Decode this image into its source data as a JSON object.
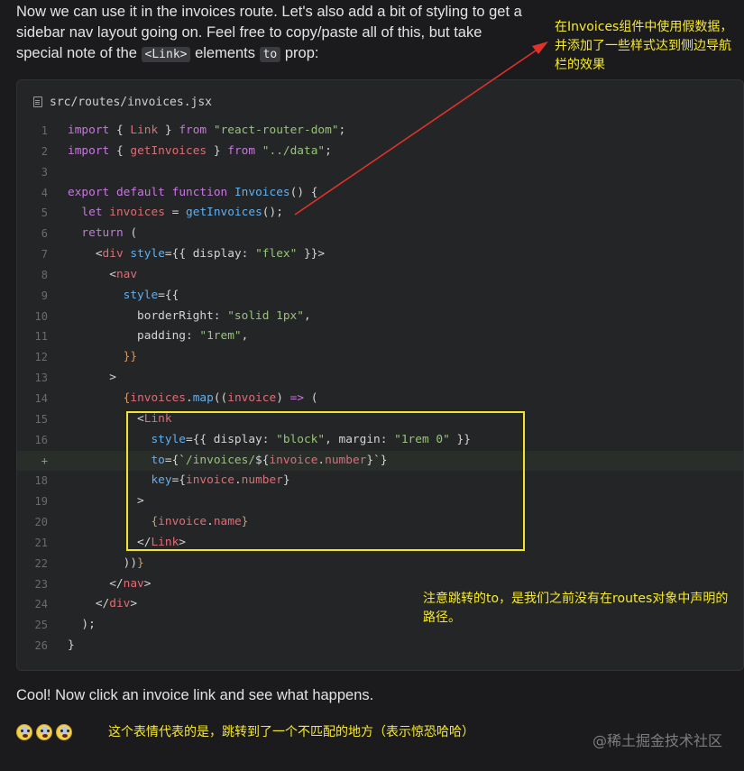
{
  "intro": {
    "part1": "Now we can use it in the invoices route. Let's also add a bit of styling to get a sidebar nav layout going on. Feel free to copy/paste all of this, but take special note of the ",
    "chip1": "<Link>",
    "part2": " elements ",
    "chip2": "to",
    "part3": " prop:"
  },
  "code_card": {
    "filename": "src/routes/invoices.jsx",
    "icon": "file-icon",
    "lines": [
      {
        "n": "1",
        "added": false,
        "tokens": [
          [
            "kw",
            "import"
          ],
          [
            "pl",
            " { "
          ],
          [
            "var",
            "Link"
          ],
          [
            "pl",
            " } "
          ],
          [
            "kw",
            "from"
          ],
          [
            "pl",
            " "
          ],
          [
            "str",
            "\"react-router-dom\""
          ],
          [
            "pl",
            ";"
          ]
        ]
      },
      {
        "n": "2",
        "added": false,
        "tokens": [
          [
            "kw",
            "import"
          ],
          [
            "pl",
            " { "
          ],
          [
            "var",
            "getInvoices"
          ],
          [
            "pl",
            " } "
          ],
          [
            "kw",
            "from"
          ],
          [
            "pl",
            " "
          ],
          [
            "str",
            "\"../data\""
          ],
          [
            "pl",
            ";"
          ]
        ]
      },
      {
        "n": "3",
        "added": false,
        "tokens": []
      },
      {
        "n": "4",
        "added": false,
        "tokens": [
          [
            "kw",
            "export"
          ],
          [
            "pl",
            " "
          ],
          [
            "kw",
            "default"
          ],
          [
            "pl",
            " "
          ],
          [
            "kw",
            "function"
          ],
          [
            "pl",
            " "
          ],
          [
            "fn",
            "Invoices"
          ],
          [
            "pl",
            "() {"
          ]
        ]
      },
      {
        "n": "5",
        "added": false,
        "tokens": [
          [
            "pl",
            "  "
          ],
          [
            "kw",
            "let"
          ],
          [
            "pl",
            " "
          ],
          [
            "var",
            "invoices"
          ],
          [
            "pl",
            " = "
          ],
          [
            "fn",
            "getInvoices"
          ],
          [
            "pl",
            "();"
          ]
        ]
      },
      {
        "n": "6",
        "added": false,
        "tokens": [
          [
            "pl",
            "  "
          ],
          [
            "kw",
            "return"
          ],
          [
            "pl",
            " ("
          ]
        ]
      },
      {
        "n": "7",
        "added": false,
        "tokens": [
          [
            "pl",
            "    <"
          ],
          [
            "tag",
            "div"
          ],
          [
            "pl",
            " "
          ],
          [
            "attr",
            "style"
          ],
          [
            "pl",
            "={{ display: "
          ],
          [
            "str",
            "\"flex\""
          ],
          [
            "pl",
            " }}>"
          ]
        ]
      },
      {
        "n": "8",
        "added": false,
        "tokens": [
          [
            "pl",
            "      <"
          ],
          [
            "tag",
            "nav"
          ]
        ]
      },
      {
        "n": "9",
        "added": false,
        "tokens": [
          [
            "pl",
            "        "
          ],
          [
            "attr",
            "style"
          ],
          [
            "pl",
            "={{"
          ]
        ]
      },
      {
        "n": "10",
        "added": false,
        "tokens": [
          [
            "pl",
            "          borderRight: "
          ],
          [
            "str",
            "\"solid 1px\""
          ],
          [
            "pl",
            ","
          ]
        ]
      },
      {
        "n": "11",
        "added": false,
        "tokens": [
          [
            "pl",
            "          padding: "
          ],
          [
            "str",
            "\"1rem\""
          ],
          [
            "pl",
            ","
          ]
        ]
      },
      {
        "n": "12",
        "added": false,
        "tokens": [
          [
            "pl",
            "        "
          ],
          [
            "br",
            "}}"
          ]
        ]
      },
      {
        "n": "13",
        "added": false,
        "tokens": [
          [
            "pl",
            "      >"
          ]
        ]
      },
      {
        "n": "14",
        "added": false,
        "tokens": [
          [
            "pl",
            "        "
          ],
          [
            "br",
            "{"
          ],
          [
            "var",
            "invoices"
          ],
          [
            "pl",
            "."
          ],
          [
            "fn",
            "map"
          ],
          [
            "pl",
            "(("
          ],
          [
            "var",
            "invoice"
          ],
          [
            "pl",
            ") "
          ],
          [
            "kw",
            "=>"
          ],
          [
            "pl",
            " ("
          ]
        ]
      },
      {
        "n": "15",
        "added": false,
        "tokens": [
          [
            "pl",
            "          <"
          ],
          [
            "tag",
            "Link"
          ]
        ]
      },
      {
        "n": "16",
        "added": false,
        "tokens": [
          [
            "pl",
            "            "
          ],
          [
            "attr",
            "style"
          ],
          [
            "pl",
            "={{ display: "
          ],
          [
            "str",
            "\"block\""
          ],
          [
            "pl",
            ", margin: "
          ],
          [
            "str",
            "\"1rem 0\""
          ],
          [
            "pl",
            " }}"
          ]
        ]
      },
      {
        "n": "+",
        "added": true,
        "tokens": [
          [
            "pl",
            "            "
          ],
          [
            "attr",
            "to"
          ],
          [
            "pl",
            "={`"
          ],
          [
            "str",
            "/invoices/"
          ],
          [
            "pl",
            "${"
          ],
          [
            "var",
            "invoice"
          ],
          [
            "pl",
            "."
          ],
          [
            "var",
            "number"
          ],
          [
            "pl",
            "}`}"
          ]
        ]
      },
      {
        "n": "18",
        "added": false,
        "tokens": [
          [
            "pl",
            "            "
          ],
          [
            "attr",
            "key"
          ],
          [
            "pl",
            "={"
          ],
          [
            "var",
            "invoice"
          ],
          [
            "pl",
            "."
          ],
          [
            "var",
            "number"
          ],
          [
            "pl",
            "}"
          ]
        ]
      },
      {
        "n": "19",
        "added": false,
        "tokens": [
          [
            "pl",
            "          >"
          ]
        ]
      },
      {
        "n": "20",
        "added": false,
        "tokens": [
          [
            "pl",
            "            "
          ],
          [
            "br",
            "{"
          ],
          [
            "var",
            "invoice"
          ],
          [
            "pl",
            "."
          ],
          [
            "var",
            "name"
          ],
          [
            "br",
            "}"
          ]
        ]
      },
      {
        "n": "21",
        "added": false,
        "tokens": [
          [
            "pl",
            "          </"
          ],
          [
            "tag",
            "Link"
          ],
          [
            "pl",
            ">"
          ]
        ]
      },
      {
        "n": "22",
        "added": false,
        "tokens": [
          [
            "pl",
            "        ))"
          ],
          [
            "br",
            "}"
          ]
        ]
      },
      {
        "n": "23",
        "added": false,
        "tokens": [
          [
            "pl",
            "      </"
          ],
          [
            "tag",
            "nav"
          ],
          [
            "pl",
            ">"
          ]
        ]
      },
      {
        "n": "24",
        "added": false,
        "tokens": [
          [
            "pl",
            "    </"
          ],
          [
            "tag",
            "div"
          ],
          [
            "pl",
            ">"
          ]
        ]
      },
      {
        "n": "25",
        "added": false,
        "tokens": [
          [
            "pl",
            "  );"
          ]
        ]
      },
      {
        "n": "26",
        "added": false,
        "tokens": [
          [
            "pl",
            "}"
          ]
        ]
      }
    ]
  },
  "annotations": {
    "top": "在Invoices组件中使用假数据，并添加了一些样式达到侧边导航栏的效果",
    "middle": "注意跳转的to，是我们之前没有在routes对象中声明的路径。",
    "bottom": "这个表情代表的是，跳转到了一个不匹配的地方（表示惊恐哈哈）"
  },
  "outro": "Cool! Now click an invoice link and see what happens.",
  "emojis": [
    "scream-emoji",
    "scream-emoji",
    "scream-emoji"
  ],
  "watermark": "@稀土掘金技术社区",
  "colors": {
    "annotation": "#f7ea2a",
    "arrow": "#e2312b",
    "highlight_box": "#f2e526",
    "background": "#1b1b1d",
    "code_bg": "#242526"
  }
}
